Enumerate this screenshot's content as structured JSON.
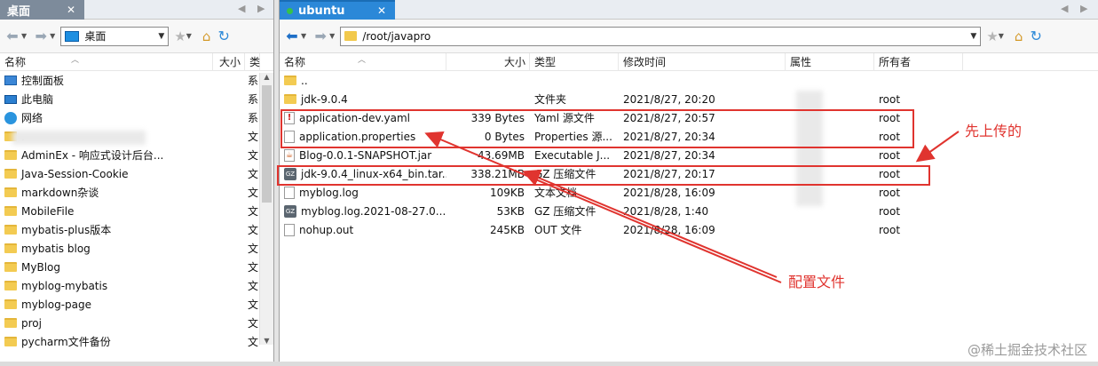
{
  "left": {
    "tab_title": "桌面",
    "path": "桌面",
    "columns": {
      "name": "名称",
      "size": "大小",
      "type": "类"
    },
    "items": [
      {
        "name": "控制面板",
        "type": "系",
        "icon": "control-panel-icon"
      },
      {
        "name": "此电脑",
        "type": "系",
        "icon": "computer-icon"
      },
      {
        "name": "网络",
        "type": "系",
        "icon": "network-icon"
      },
      {
        "name": ".",
        "type": "文",
        "icon": "folder-icon"
      },
      {
        "name": "AdminEx - 响应式设计后台...",
        "type": "文",
        "icon": "folder-icon"
      },
      {
        "name": "Java-Session-Cookie",
        "type": "文",
        "icon": "folder-icon"
      },
      {
        "name": "markdown杂谈",
        "type": "文",
        "icon": "folder-icon"
      },
      {
        "name": "MobileFile",
        "type": "文",
        "icon": "folder-icon"
      },
      {
        "name": "mybatis-plus版本",
        "type": "文",
        "icon": "folder-icon"
      },
      {
        "name": "mybatis blog",
        "type": "文",
        "icon": "folder-icon"
      },
      {
        "name": "MyBlog",
        "type": "文",
        "icon": "folder-icon"
      },
      {
        "name": "myblog-mybatis",
        "type": "文",
        "icon": "folder-icon"
      },
      {
        "name": "myblog-page",
        "type": "文",
        "icon": "folder-icon"
      },
      {
        "name": "proj",
        "type": "文",
        "icon": "folder-icon"
      },
      {
        "name": "pycharm文件备份",
        "type": "文",
        "icon": "folder-icon"
      }
    ]
  },
  "right": {
    "tab_title": "ubuntu",
    "path": "/root/javapro",
    "columns": {
      "name": "名称",
      "size": "大小",
      "type": "类型",
      "modified": "修改时间",
      "attrs": "属性",
      "owner": "所有者"
    },
    "items": [
      {
        "name": "..",
        "size": "",
        "type": "",
        "modified": "",
        "attrs": "",
        "owner": "",
        "icon": "folder-icon"
      },
      {
        "name": "jdk-9.0.4",
        "size": "",
        "type": "文件夹",
        "modified": "2021/8/27, 20:20",
        "attrs": "",
        "owner": "root",
        "icon": "folder-icon"
      },
      {
        "name": "application-dev.yaml",
        "size": "339 Bytes",
        "type": "Yaml 源文件",
        "modified": "2021/8/27, 20:57",
        "attrs": "",
        "owner": "root",
        "icon": "yaml-file-icon"
      },
      {
        "name": "application.properties",
        "size": "0 Bytes",
        "type": "Properties 源...",
        "modified": "2021/8/27, 20:34",
        "attrs": "",
        "owner": "root",
        "icon": "file-icon"
      },
      {
        "name": "Blog-0.0.1-SNAPSHOT.jar",
        "size": "43.69MB",
        "type": "Executable J...",
        "modified": "2021/8/27, 20:34",
        "attrs": "",
        "owner": "root",
        "icon": "jar-file-icon"
      },
      {
        "name": "jdk-9.0.4_linux-x64_bin.tar...",
        "size": "338.21MB",
        "type": "GZ 压缩文件",
        "modified": "2021/8/27, 20:17",
        "attrs": "",
        "owner": "root",
        "icon": "gz-archive-icon"
      },
      {
        "name": "myblog.log",
        "size": "109KB",
        "type": "文本文档",
        "modified": "2021/8/28, 16:09",
        "attrs": "",
        "owner": "root",
        "icon": "file-icon"
      },
      {
        "name": "myblog.log.2021-08-27.0...",
        "size": "53KB",
        "type": "GZ 压缩文件",
        "modified": "2021/8/28, 1:40",
        "attrs": "",
        "owner": "root",
        "icon": "gz-archive-icon"
      },
      {
        "name": "nohup.out",
        "size": "245KB",
        "type": "OUT 文件",
        "modified": "2021/8/28, 16:09",
        "attrs": "",
        "owner": "root",
        "icon": "file-icon"
      }
    ]
  },
  "annotations": {
    "uploaded_first": "先上传的",
    "config_files": "配置文件"
  },
  "watermark": "@稀土掘金技术社区",
  "colors": {
    "accent": "#2b88d8",
    "annotation": "#e0342f"
  }
}
